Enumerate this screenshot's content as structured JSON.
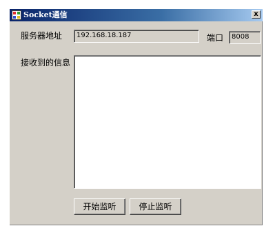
{
  "window": {
    "title": "Socket通信",
    "close_glyph": "x",
    "icon": "application-icon"
  },
  "form": {
    "server_address_label": "服务器地址",
    "server_address_value": "192.168.18.187",
    "port_label": "端口",
    "port_value": "8008",
    "received_label": "接收到的信息",
    "received_value": ""
  },
  "buttons": {
    "start_label": "开始监听",
    "stop_label": "停止监听"
  },
  "colors": {
    "titlebar_start": "#0a246a",
    "titlebar_end": "#a6caf0",
    "window_face": "#d4d0c8"
  }
}
